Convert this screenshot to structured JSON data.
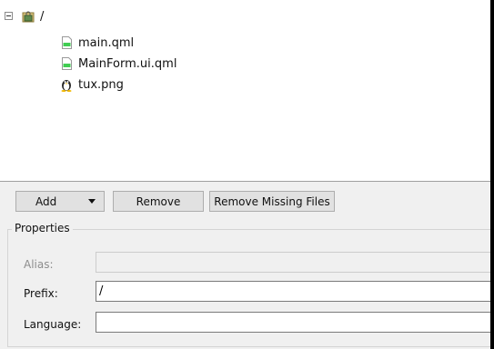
{
  "tree": {
    "root": {
      "label": "/",
      "expander": "minus",
      "icon": "lock-folder-icon"
    },
    "children": [
      {
        "label": "main.qml",
        "icon": "qml-file-icon"
      },
      {
        "label": "MainForm.ui.qml",
        "icon": "qml-file-icon"
      },
      {
        "label": "tux.png",
        "icon": "tux-penguin-icon"
      }
    ]
  },
  "toolbar": {
    "add_label": "Add",
    "remove_label": "Remove",
    "remove_missing_label": "Remove Missing Files"
  },
  "properties": {
    "title": "Properties",
    "alias": {
      "label": "Alias:",
      "value": "",
      "enabled": false
    },
    "prefix": {
      "label": "Prefix:",
      "value": "/"
    },
    "language": {
      "label": "Language:",
      "value": ""
    }
  }
}
